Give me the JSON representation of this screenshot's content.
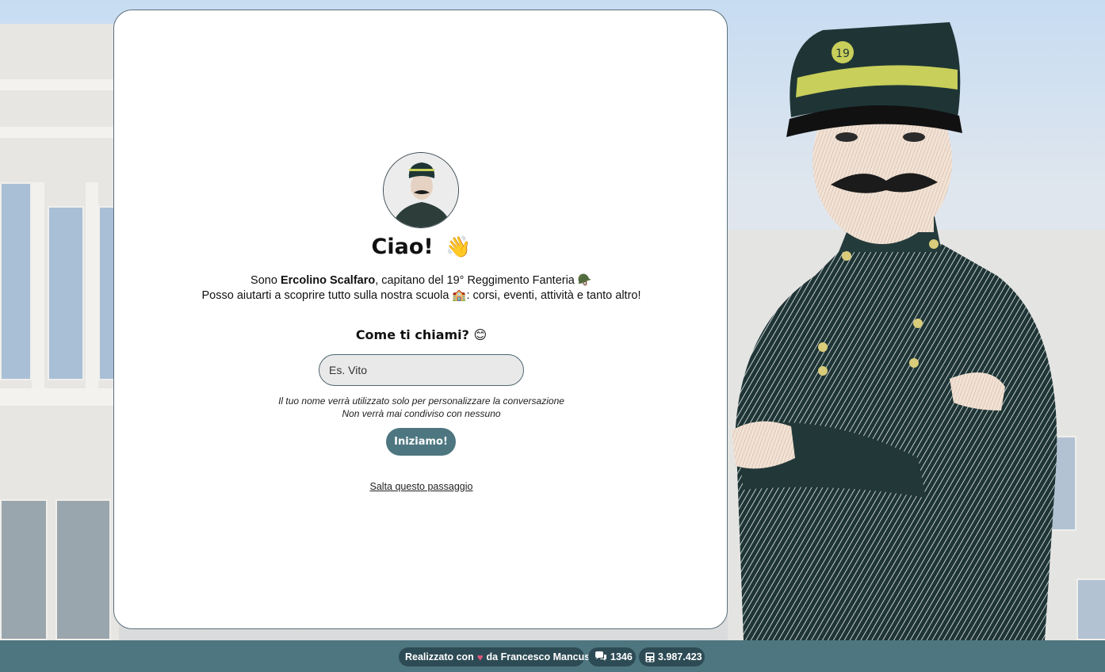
{
  "card": {
    "title": "Ciao!",
    "title_emoji": "👋",
    "intro_line1_prefix": "Sono ",
    "intro_name": "Ercolino Scalfaro",
    "intro_line1_suffix": ", capitano del 19° Reggimento Fanteria 🪖",
    "intro_line2": "Posso aiutarti a scoprire tutto sulla nostra scuola 🏫: corsi, eventi, attività e tanto altro!",
    "ask": "Come ti chiami? 😊",
    "input_placeholder": "Es. Vito",
    "input_value": "",
    "privacy_line1": "Il tuo nome verrà utilizzato solo per personalizzare la conversazione",
    "privacy_line2": "Non verrà mai condiviso con nessuno",
    "start_label": "Iniziamo!",
    "skip_label": "Salta questo passaggio"
  },
  "footer": {
    "made_prefix": "Realizzato con",
    "made_suffix": "da Francesco Mancuso",
    "heart_icon": "heart-icon",
    "chats_icon": "chat-bubbles-icon",
    "chats_count": "1346",
    "counter_icon": "calculator-icon",
    "counter_value": "3.987.423"
  },
  "colors": {
    "accent": "#4d7680",
    "pill": "#2d4b54",
    "heart": "#e0567b"
  }
}
